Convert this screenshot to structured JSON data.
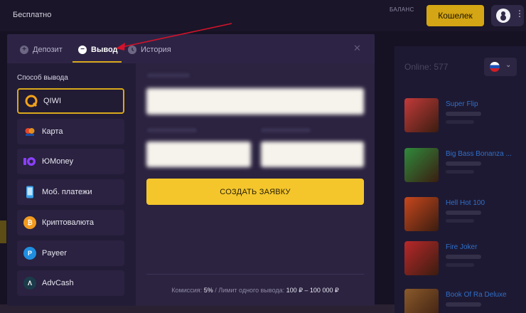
{
  "header": {
    "brand_free": "Бесплатно",
    "balance_label": "БАЛАНС",
    "wallet_button": "Кошелек",
    "more_glyph": "⋮"
  },
  "right_panel": {
    "online": "Online: 577",
    "language_icon": "flag-ru-icon",
    "chevron": "⌄",
    "games": [
      {
        "name": "Super Flip",
        "color": "#c23a3a"
      },
      {
        "name": "Big Bass Bonanza ...",
        "color": "#2f8a3c"
      },
      {
        "name": "Hell Hot 100",
        "color": "#c7471d"
      },
      {
        "name": "Fire Joker",
        "color": "#b8282a"
      },
      {
        "name": "Book Of Ra Deluxe",
        "color": "#8a5a2b"
      }
    ]
  },
  "modal": {
    "tabs": [
      {
        "label": "Депозит",
        "icon": "plus-icon",
        "glyph": "+"
      },
      {
        "label": "Вывод",
        "icon": "minus-icon",
        "glyph": "−"
      },
      {
        "label": "История",
        "icon": "clock-icon",
        "glyph": ""
      }
    ],
    "active_tab": "Вывод",
    "close": "✕",
    "methods_title": "Способ вывода",
    "methods": [
      {
        "label": "QIWI",
        "icon": "qiwi-icon",
        "color": "#f2a31b",
        "glyph": "Q",
        "active": true
      },
      {
        "label": "Карта",
        "icon": "card-icon",
        "color": "#e2462e",
        "glyph": "",
        "active": false
      },
      {
        "label": "ЮMoney",
        "icon": "yoomoney-icon",
        "color": "#8b3ffd",
        "glyph": "Ю",
        "active": false
      },
      {
        "label": "Моб. платежи",
        "icon": "phone-icon",
        "color": "#3aa0e8",
        "glyph": "",
        "active": false
      },
      {
        "label": "Криптовалюта",
        "icon": "bitcoin-icon",
        "color": "#f29a1f",
        "glyph": "₿",
        "active": false
      },
      {
        "label": "Payeer",
        "icon": "payeer-icon",
        "color": "#1f8ee0",
        "glyph": "P",
        "active": false
      },
      {
        "label": "AdvCash",
        "icon": "advcash-icon",
        "color": "#1c3b4a",
        "glyph": "Λ",
        "active": false
      }
    ],
    "submit_button": "СОЗДАТЬ ЗАЯВКУ",
    "footer": {
      "commission_label": "Комиссия:",
      "commission_value": "5%",
      "separator": "/",
      "limit_label": "Лимит одного вывода:",
      "limit_value": "100 ₽ – 100 000 ₽"
    }
  },
  "colors": {
    "accent": "#f4c62b",
    "modal_bg": "#2d2445",
    "arrow": "#d3132a"
  }
}
